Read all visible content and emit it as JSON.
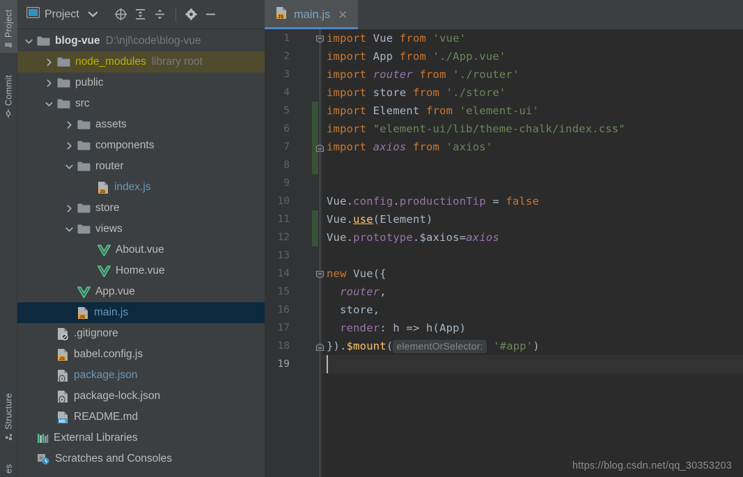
{
  "tool_window_tabs": [
    {
      "label": "Project",
      "icon": "project-folder-icon",
      "active": true
    },
    {
      "label": "Commit",
      "icon": "commit-icon",
      "active": false
    },
    {
      "label": "Structure",
      "icon": "structure-icon",
      "active": false
    },
    {
      "label": "es",
      "icon": "services-icon",
      "active": false
    }
  ],
  "project_panel": {
    "title": "Project",
    "toolbar_buttons": [
      {
        "name": "select-opened-file-icon",
        "label": "Select Opened File"
      },
      {
        "name": "expand-all-icon",
        "label": "Expand All"
      },
      {
        "name": "collapse-all-icon",
        "label": "Collapse All"
      },
      {
        "name": "settings-gear-icon",
        "label": "Options"
      },
      {
        "name": "hide-icon",
        "label": "Hide"
      }
    ],
    "tree": [
      {
        "label": "blog-vue",
        "sub": "D:\\njl\\code\\blog-vue",
        "indent": 0,
        "arrow": "down",
        "icon": "folder-module-icon",
        "style": "bold",
        "state": "none"
      },
      {
        "label": "node_modules",
        "sub": "library root",
        "indent": 1,
        "arrow": "right",
        "icon": "folder-icon",
        "style": "yellow",
        "state": "selected-node"
      },
      {
        "label": "public",
        "sub": "",
        "indent": 1,
        "arrow": "right",
        "icon": "folder-icon",
        "style": "normal",
        "state": "none"
      },
      {
        "label": "src",
        "sub": "",
        "indent": 1,
        "arrow": "down",
        "icon": "folder-icon",
        "style": "normal",
        "state": "none"
      },
      {
        "label": "assets",
        "sub": "",
        "indent": 2,
        "arrow": "right",
        "icon": "folder-icon",
        "style": "normal",
        "state": "none"
      },
      {
        "label": "components",
        "sub": "",
        "indent": 2,
        "arrow": "right",
        "icon": "folder-icon",
        "style": "normal",
        "state": "none"
      },
      {
        "label": "router",
        "sub": "",
        "indent": 2,
        "arrow": "down",
        "icon": "folder-icon",
        "style": "normal",
        "state": "none"
      },
      {
        "label": "index.js",
        "sub": "",
        "indent": 3,
        "arrow": "none",
        "icon": "js-file-icon",
        "style": "blue",
        "state": "none"
      },
      {
        "label": "store",
        "sub": "",
        "indent": 2,
        "arrow": "right",
        "icon": "folder-icon",
        "style": "normal",
        "state": "none"
      },
      {
        "label": "views",
        "sub": "",
        "indent": 2,
        "arrow": "down",
        "icon": "folder-icon",
        "style": "normal",
        "state": "none"
      },
      {
        "label": "About.vue",
        "sub": "",
        "indent": 3,
        "arrow": "none",
        "icon": "vue-file-icon",
        "style": "normal",
        "state": "none"
      },
      {
        "label": "Home.vue",
        "sub": "",
        "indent": 3,
        "arrow": "none",
        "icon": "vue-file-icon",
        "style": "normal",
        "state": "none"
      },
      {
        "label": "App.vue",
        "sub": "",
        "indent": 2,
        "arrow": "none",
        "icon": "vue-file-icon",
        "style": "normal",
        "state": "none"
      },
      {
        "label": "main.js",
        "sub": "",
        "indent": 2,
        "arrow": "none",
        "icon": "js-file-icon",
        "style": "blue",
        "state": "selected-focus"
      },
      {
        "label": ".gitignore",
        "sub": "",
        "indent": 1,
        "arrow": "none",
        "icon": "gitignore-file-icon",
        "style": "normal",
        "state": "none"
      },
      {
        "label": "babel.config.js",
        "sub": "",
        "indent": 1,
        "arrow": "none",
        "icon": "js-file-icon",
        "style": "normal",
        "state": "none"
      },
      {
        "label": "package.json",
        "sub": "",
        "indent": 1,
        "arrow": "none",
        "icon": "json-file-icon",
        "style": "blue",
        "state": "none"
      },
      {
        "label": "package-lock.json",
        "sub": "",
        "indent": 1,
        "arrow": "none",
        "icon": "json-file-icon",
        "style": "normal",
        "state": "none"
      },
      {
        "label": "README.md",
        "sub": "",
        "indent": 1,
        "arrow": "none",
        "icon": "md-file-icon",
        "style": "normal",
        "state": "none"
      },
      {
        "label": "External Libraries",
        "sub": "",
        "indent": 0,
        "arrow": "none",
        "icon": "libraries-icon",
        "style": "normal",
        "state": "none"
      },
      {
        "label": "Scratches and Consoles",
        "sub": "",
        "indent": 0,
        "arrow": "none",
        "icon": "scratches-icon",
        "style": "normal",
        "state": "none"
      }
    ]
  },
  "editor": {
    "tabs": [
      {
        "label": "main.js",
        "icon": "js-file-icon",
        "close": "✕",
        "active": true
      }
    ],
    "current_line": 19,
    "change_bars": [
      {
        "from": 5,
        "to": 8
      },
      {
        "from": 11,
        "to": 12
      }
    ],
    "folds": [
      1,
      7,
      14,
      18
    ],
    "lines": [
      {
        "n": 1,
        "tokens": [
          {
            "t": "import ",
            "c": "k"
          },
          {
            "t": "Vue",
            "c": "idn"
          },
          {
            "t": " ",
            "c": "idn"
          },
          {
            "t": "from",
            "c": "k"
          },
          {
            "t": " ",
            "c": "idn"
          },
          {
            "t": "'vue'",
            "c": "str"
          }
        ]
      },
      {
        "n": 2,
        "tokens": [
          {
            "t": "import ",
            "c": "k"
          },
          {
            "t": "App",
            "c": "idn"
          },
          {
            "t": " ",
            "c": "idn"
          },
          {
            "t": "from",
            "c": "k"
          },
          {
            "t": " ",
            "c": "idn"
          },
          {
            "t": "'./App.vue'",
            "c": "str"
          }
        ]
      },
      {
        "n": 3,
        "tokens": [
          {
            "t": "import ",
            "c": "k"
          },
          {
            "t": "router",
            "c": "itl"
          },
          {
            "t": " ",
            "c": "idn"
          },
          {
            "t": "from",
            "c": "k"
          },
          {
            "t": " ",
            "c": "idn"
          },
          {
            "t": "'./router'",
            "c": "str"
          }
        ]
      },
      {
        "n": 4,
        "tokens": [
          {
            "t": "import ",
            "c": "k"
          },
          {
            "t": "store",
            "c": "idn"
          },
          {
            "t": " ",
            "c": "idn"
          },
          {
            "t": "from",
            "c": "k"
          },
          {
            "t": " ",
            "c": "idn"
          },
          {
            "t": "'./store'",
            "c": "str"
          }
        ]
      },
      {
        "n": 5,
        "tokens": [
          {
            "t": "import ",
            "c": "k"
          },
          {
            "t": "Element",
            "c": "idn"
          },
          {
            "t": " ",
            "c": "idn"
          },
          {
            "t": "from",
            "c": "k"
          },
          {
            "t": " ",
            "c": "idn"
          },
          {
            "t": "'element-ui'",
            "c": "str"
          }
        ]
      },
      {
        "n": 6,
        "tokens": [
          {
            "t": "import ",
            "c": "k"
          },
          {
            "t": "\"element-ui/lib/theme-chalk/index.css\"",
            "c": "str"
          }
        ]
      },
      {
        "n": 7,
        "tokens": [
          {
            "t": "import ",
            "c": "k"
          },
          {
            "t": "axios",
            "c": "itl"
          },
          {
            "t": " ",
            "c": "idn"
          },
          {
            "t": "from",
            "c": "k"
          },
          {
            "t": " ",
            "c": "idn"
          },
          {
            "t": "'axios'",
            "c": "str"
          }
        ]
      },
      {
        "n": 8,
        "tokens": []
      },
      {
        "n": 9,
        "tokens": []
      },
      {
        "n": 10,
        "tokens": [
          {
            "t": "Vue",
            "c": "idn"
          },
          {
            "t": ".",
            "c": "idn"
          },
          {
            "t": "config",
            "c": "prp"
          },
          {
            "t": ".",
            "c": "idn"
          },
          {
            "t": "productionTip",
            "c": "prp"
          },
          {
            "t": " = ",
            "c": "idn"
          },
          {
            "t": "false",
            "c": "k"
          }
        ]
      },
      {
        "n": 11,
        "tokens": [
          {
            "t": "Vue",
            "c": "idn"
          },
          {
            "t": ".",
            "c": "idn"
          },
          {
            "t": "use",
            "c": "fnu"
          },
          {
            "t": "(",
            "c": "idn"
          },
          {
            "t": "Element",
            "c": "idn"
          },
          {
            "t": ")",
            "c": "idn"
          }
        ]
      },
      {
        "n": 12,
        "tokens": [
          {
            "t": "Vue",
            "c": "idn"
          },
          {
            "t": ".",
            "c": "idn"
          },
          {
            "t": "prototype",
            "c": "prp"
          },
          {
            "t": ".",
            "c": "idn"
          },
          {
            "t": "$axios",
            "c": "idn"
          },
          {
            "t": "=",
            "c": "idn"
          },
          {
            "t": "axios",
            "c": "itl"
          }
        ]
      },
      {
        "n": 13,
        "tokens": []
      },
      {
        "n": 14,
        "tokens": [
          {
            "t": "new",
            "c": "k"
          },
          {
            "t": " ",
            "c": "idn"
          },
          {
            "t": "Vue",
            "c": "idn"
          },
          {
            "t": "({",
            "c": "idn"
          }
        ]
      },
      {
        "n": 15,
        "tokens": [
          {
            "t": "  ",
            "c": "idn"
          },
          {
            "t": "router",
            "c": "itl"
          },
          {
            "t": ",",
            "c": "idn"
          }
        ]
      },
      {
        "n": 16,
        "tokens": [
          {
            "t": "  ",
            "c": "idn"
          },
          {
            "t": "store",
            "c": "idn"
          },
          {
            "t": ",",
            "c": "idn"
          }
        ]
      },
      {
        "n": 17,
        "tokens": [
          {
            "t": "  ",
            "c": "idn"
          },
          {
            "t": "render",
            "c": "prp"
          },
          {
            "t": ": h => h(App)",
            "c": "idn"
          }
        ]
      },
      {
        "n": 18,
        "tokens": [
          {
            "t": "}).",
            "c": "idn"
          },
          {
            "t": "$mount",
            "c": "fn"
          },
          {
            "t": "(",
            "c": "idn"
          },
          {
            "t": "elementOrSelector:",
            "c": "hint"
          },
          {
            "t": " ",
            "c": "idn"
          },
          {
            "t": "'#app'",
            "c": "str"
          },
          {
            "t": ")",
            "c": "idn"
          }
        ]
      },
      {
        "n": 19,
        "tokens": []
      }
    ]
  },
  "watermark": {
    "url": "https://blog.csdn.net/qq_30353203"
  },
  "colors": {
    "panel_bg": "#3c3f41",
    "editor_bg": "#2b2b2b",
    "gutter_bg": "#313335",
    "accent_blue": "#4a88c7",
    "selection_focus": "#0d293e",
    "selection_node": "#514b2e",
    "change_bar_green": "#375239"
  }
}
